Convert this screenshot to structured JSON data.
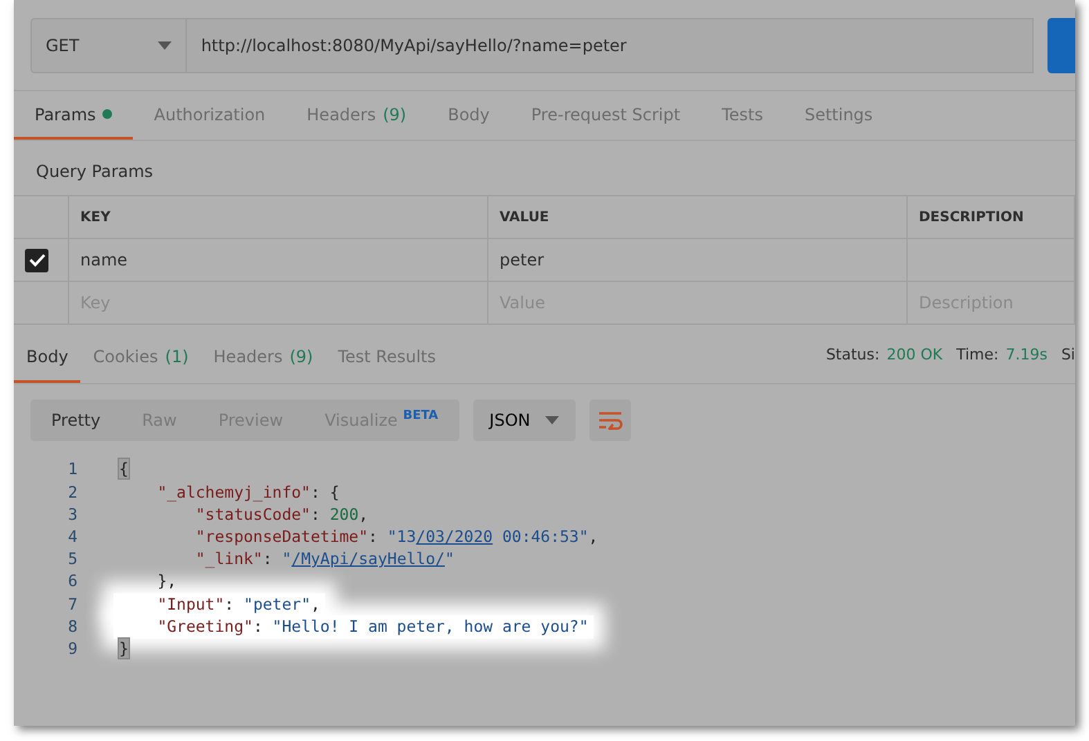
{
  "request": {
    "method": "GET",
    "url": "http://localhost:8080/MyApi/sayHello/?name=peter"
  },
  "request_tabs": [
    {
      "label": "Params",
      "dot": true,
      "selected": true
    },
    {
      "label": "Authorization",
      "dot": false,
      "selected": false
    },
    {
      "label": "Headers",
      "count": "(9)",
      "dot": false,
      "selected": false
    },
    {
      "label": "Body",
      "dot": false,
      "selected": false
    },
    {
      "label": "Pre-request Script",
      "dot": false,
      "selected": false
    },
    {
      "label": "Tests",
      "dot": false,
      "selected": false
    },
    {
      "label": "Settings",
      "dot": false,
      "selected": false
    }
  ],
  "query_params": {
    "title": "Query Params",
    "columns": [
      "KEY",
      "VALUE",
      "DESCRIPTION"
    ],
    "rows": [
      {
        "checked": true,
        "key": "name",
        "value": "peter"
      }
    ],
    "new_row": {
      "key_placeholder": "Key",
      "value_placeholder": "Value",
      "description_placeholder": "Description"
    }
  },
  "response_tabs": [
    {
      "label": "Body",
      "selected": true
    },
    {
      "label": "Cookies",
      "count": "(1)",
      "selected": false
    },
    {
      "label": "Headers",
      "count": "(9)",
      "selected": false
    },
    {
      "label": "Test Results",
      "selected": false
    }
  ],
  "status": [
    {
      "label": "Status:",
      "value": "200 OK"
    },
    {
      "label": "Time:",
      "value": "7.19s"
    },
    {
      "label": "Si"
    }
  ],
  "view_modes": [
    {
      "label": "Pretty",
      "selected": true
    },
    {
      "label": "Raw",
      "selected": false
    },
    {
      "label": "Preview",
      "selected": false
    },
    {
      "label": "Visualize",
      "badge": "BETA",
      "selected": false
    }
  ],
  "format": "JSON",
  "code_lines": [
    {
      "number": "1",
      "highlighted": false,
      "tokens": [
        {
          "kind": "bracket",
          "text": "{"
        }
      ]
    },
    {
      "number": "2",
      "highlighted": false,
      "tokens": [
        {
          "kind": "key",
          "text": "    \"_alchemyj_info\""
        },
        {
          "kind": "punct",
          "text": ": {"
        }
      ]
    },
    {
      "number": "3",
      "highlighted": false,
      "tokens": [
        {
          "kind": "key",
          "text": "        \"statusCode\""
        },
        {
          "kind": "punct",
          "text": ": "
        },
        {
          "kind": "number",
          "text": "200"
        },
        {
          "kind": "punct",
          "text": ","
        }
      ]
    },
    {
      "number": "4",
      "highlighted": false,
      "tokens": [
        {
          "kind": "key",
          "text": "        \"responseDatetime\""
        },
        {
          "kind": "punct",
          "text": ": "
        },
        {
          "kind": "string",
          "text": "\"13"
        },
        {
          "kind": "link",
          "text": "/03/2020"
        },
        {
          "kind": "string",
          "text": " 00:46:53\""
        },
        {
          "kind": "punct",
          "text": ","
        }
      ]
    },
    {
      "number": "5",
      "highlighted": false,
      "tokens": [
        {
          "kind": "key",
          "text": "        \"_link\""
        },
        {
          "kind": "punct",
          "text": ": "
        },
        {
          "kind": "string",
          "text": "\""
        },
        {
          "kind": "link",
          "text": "/MyApi/sayHello/"
        },
        {
          "kind": "string",
          "text": "\""
        }
      ]
    },
    {
      "number": "6",
      "highlighted": false,
      "tokens": [
        {
          "kind": "punct",
          "text": "    },"
        }
      ]
    },
    {
      "number": "7",
      "highlighted": true,
      "tokens": [
        {
          "kind": "key",
          "text": "    \"Input\""
        },
        {
          "kind": "punct",
          "text": ": "
        },
        {
          "kind": "string",
          "text": "\"peter\""
        },
        {
          "kind": "punct",
          "text": ","
        }
      ]
    },
    {
      "number": "8",
      "highlighted": true,
      "tokens": [
        {
          "kind": "key",
          "text": "    \"Greeting\""
        },
        {
          "kind": "punct",
          "text": ": "
        },
        {
          "kind": "string",
          "text": "\"Hello! I am peter, how are you?\""
        }
      ]
    },
    {
      "number": "9",
      "highlighted": false,
      "tokens": [
        {
          "kind": "bracket",
          "text": "}"
        }
      ]
    }
  ]
}
